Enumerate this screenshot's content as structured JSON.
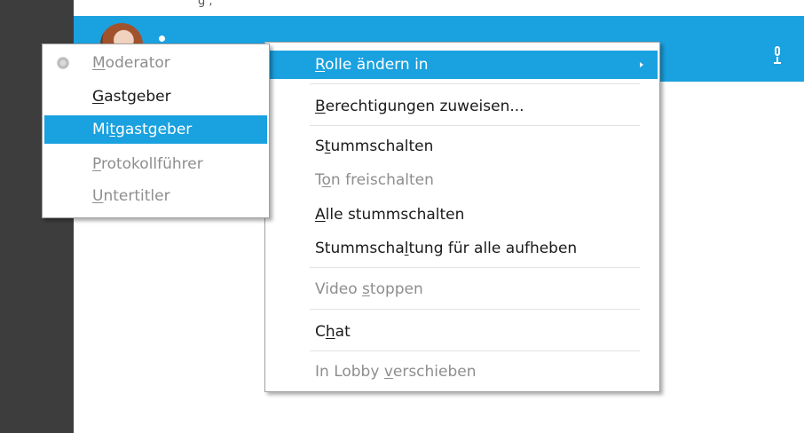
{
  "participant": {
    "name_fragment": "",
    "top_fragment": "g  ,",
    "mic_icon": "mic-icon"
  },
  "main_menu": {
    "items": [
      {
        "pre": "",
        "acc": "R",
        "post": "olle ändern in",
        "state": "highlight",
        "has_submenu": true
      },
      {
        "pre": "",
        "acc": "B",
        "post": "erechtigungen zuweisen...",
        "state": "enabled"
      },
      {
        "pre": "S",
        "acc": "t",
        "post": "ummschalten",
        "state": "enabled"
      },
      {
        "pre": "T",
        "acc": "o",
        "post": "n freischalten",
        "state": "disabled"
      },
      {
        "pre": "",
        "acc": "A",
        "post": "lle stummschalten",
        "state": "enabled"
      },
      {
        "pre": "Stummscha",
        "acc": "l",
        "post": "tung für alle aufheben",
        "state": "enabled"
      },
      {
        "pre": "Video ",
        "acc": "s",
        "post": "toppen",
        "state": "disabled"
      },
      {
        "pre": "C",
        "acc": "h",
        "post": "at",
        "state": "enabled"
      },
      {
        "pre": "In Lobby ",
        "acc": "v",
        "post": "erschieben",
        "state": "disabled"
      }
    ]
  },
  "role_menu": {
    "items": [
      {
        "pre": "",
        "acc": "M",
        "post": "oderator",
        "state": "disabled",
        "checked": true
      },
      {
        "pre": "",
        "acc": "G",
        "post": "astgeber",
        "state": "enabled"
      },
      {
        "pre": "Mi",
        "acc": "t",
        "post": "gastgeber",
        "state": "highlight"
      },
      {
        "pre": "",
        "acc": "P",
        "post": "rotokollführer",
        "state": "disabled"
      },
      {
        "pre": "",
        "acc": "U",
        "post": "ntertitler",
        "state": "disabled"
      }
    ]
  },
  "colors": {
    "accent": "#1aa1df",
    "sidebar": "#3d3d3d",
    "disabled_text": "#8e8e8e"
  }
}
